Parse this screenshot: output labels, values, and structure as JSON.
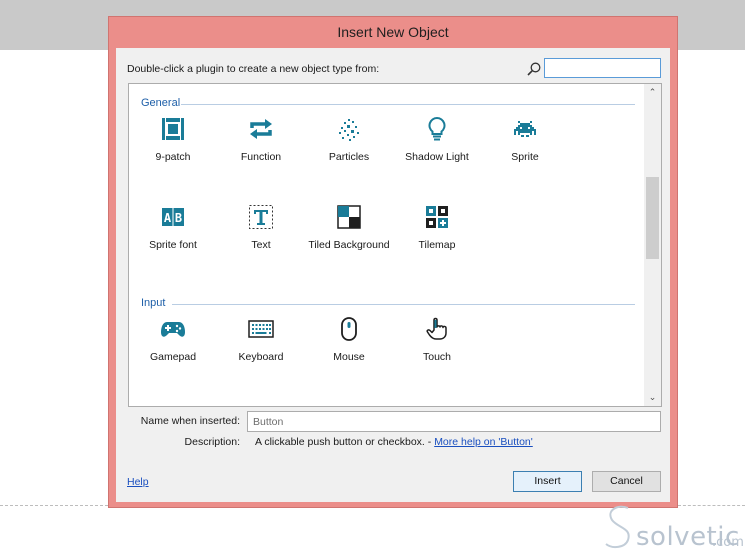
{
  "dialog": {
    "title": "Insert New Object"
  },
  "prompt": "Double-click a plugin to create a new object type from:",
  "search": {
    "value": "",
    "placeholder": ""
  },
  "groups": [
    {
      "label": "General",
      "items": [
        {
          "label": "9-patch",
          "icon": "nine-patch-icon"
        },
        {
          "label": "Function",
          "icon": "function-icon"
        },
        {
          "label": "Particles",
          "icon": "particles-icon"
        },
        {
          "label": "Shadow Light",
          "icon": "shadow-light-icon"
        },
        {
          "label": "Sprite",
          "icon": "sprite-icon"
        },
        {
          "label": "Sprite font",
          "icon": "sprite-font-icon"
        },
        {
          "label": "Text",
          "icon": "text-icon"
        },
        {
          "label": "Tiled Background",
          "icon": "tiled-background-icon"
        },
        {
          "label": "Tilemap",
          "icon": "tilemap-icon"
        }
      ]
    },
    {
      "label": "Input",
      "items": [
        {
          "label": "Gamepad",
          "icon": "gamepad-icon"
        },
        {
          "label": "Keyboard",
          "icon": "keyboard-icon"
        },
        {
          "label": "Mouse",
          "icon": "mouse-icon"
        },
        {
          "label": "Touch",
          "icon": "touch-icon"
        }
      ]
    }
  ],
  "scroll": {
    "up_glyph": "⌃",
    "down_glyph": "⌄"
  },
  "name_field": {
    "label": "Name when inserted:",
    "value": "Button"
  },
  "description": {
    "label": "Description:",
    "text": "A clickable push button or checkbox. - ",
    "link": "More help on 'Button'"
  },
  "footer": {
    "help": "Help",
    "insert": "Insert",
    "cancel": "Cancel"
  },
  "watermark": {
    "text": "solvetic",
    "suffix": ".com"
  },
  "colors": {
    "accent": "#1a7c98",
    "title_bar": "#eb8e8a",
    "group_header": "#1e5fa8",
    "link": "#1a4fbf"
  }
}
